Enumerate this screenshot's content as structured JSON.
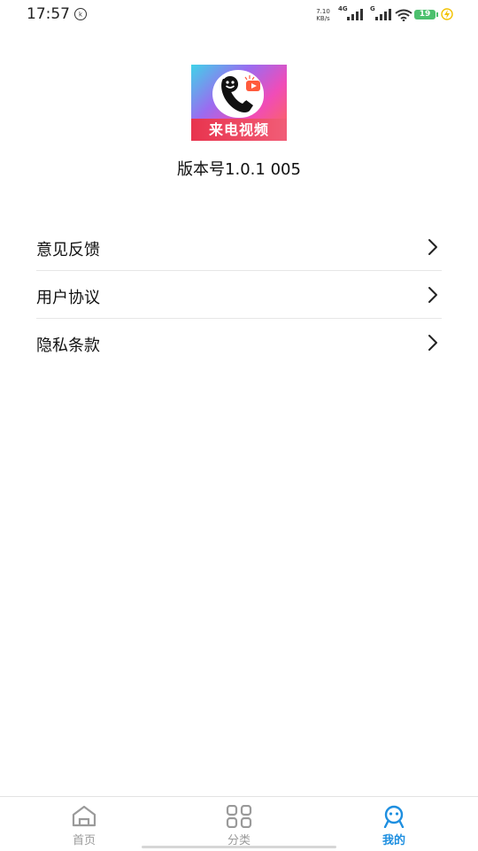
{
  "status_bar": {
    "time": "17:57",
    "hd_badge": "𝗁",
    "net_speed_value": "7.10",
    "net_speed_unit": "KB/s",
    "sim1_label": "4G",
    "sim2_label": "G",
    "battery_level": "19",
    "battery_color": "#4cc06e"
  },
  "app": {
    "logo_text": "来电视频",
    "version": "版本号1.0.1 005"
  },
  "menu": {
    "items": [
      {
        "label": "意见反馈"
      },
      {
        "label": "用户协议"
      },
      {
        "label": "隐私条款"
      }
    ]
  },
  "tab_bar": {
    "active_color": "#1e8fe0",
    "tabs": [
      {
        "label": "首页",
        "icon": "home-icon"
      },
      {
        "label": "分类",
        "icon": "grid-icon"
      },
      {
        "label": "我的",
        "icon": "profile-chat-icon"
      }
    ],
    "active_index": 2
  }
}
